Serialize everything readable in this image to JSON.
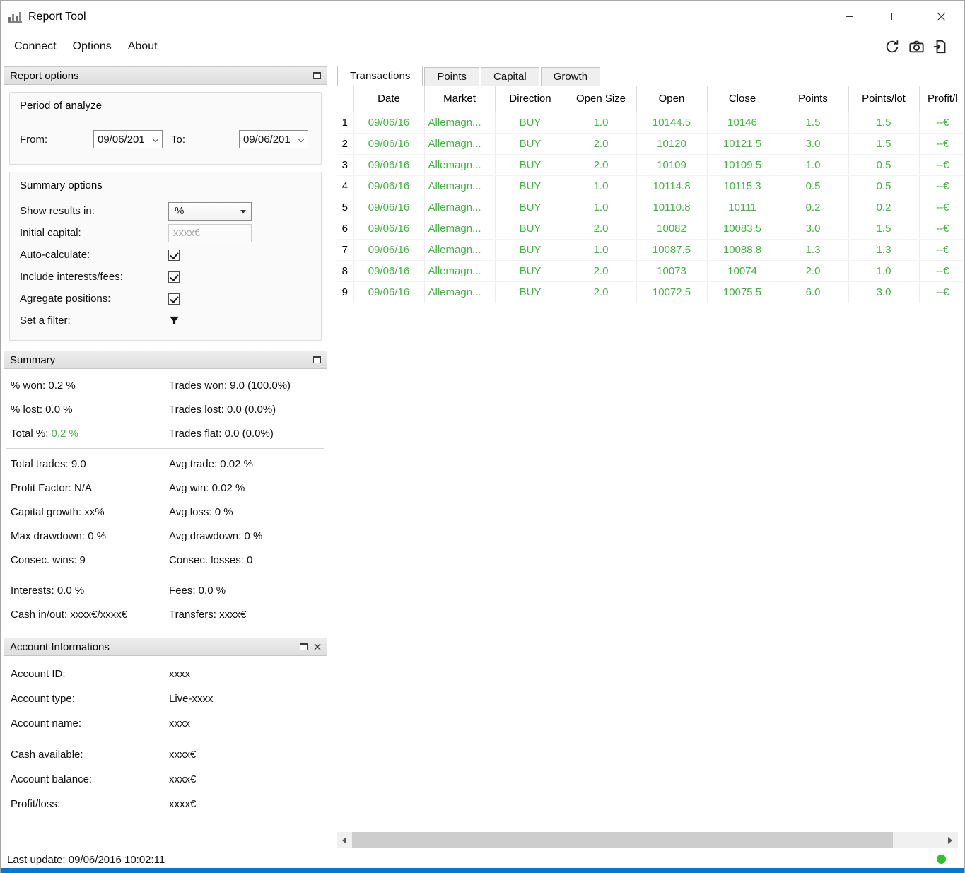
{
  "window": {
    "title": "Report Tool"
  },
  "menubar": {
    "items": [
      "Connect",
      "Options",
      "About"
    ]
  },
  "icons": {
    "app_icon": "bar-chart",
    "refresh_icon": "circular-arrows",
    "camera_icon": "camera",
    "export_icon": "export-arrow",
    "filter_icon": "funnel",
    "status_indicator": "green-dot"
  },
  "colors": {
    "green": "#3fb63f",
    "accent_blue": "#0078d7",
    "status_dot": "#2fc12f"
  },
  "report_options": {
    "header": "Report options",
    "period": {
      "title": "Period of analyze",
      "from_label": "From:",
      "from_value": "09/06/201",
      "to_label": "To:",
      "to_value": "09/06/201"
    },
    "options": {
      "title": "Summary options",
      "show_results_label": "Show results in:",
      "show_results_value": "%",
      "initial_capital_label": "Initial capital:",
      "initial_capital_value": "xxxx€",
      "auto_calculate_label": "Auto-calculate:",
      "interests_label": "Include interests/fees:",
      "agregate_label": "Agregate positions:",
      "filter_label": "Set a filter:"
    }
  },
  "summary": {
    "header": "Summary",
    "g1": [
      {
        "l": "% won: 0.2 %",
        "r": "Trades won: 9.0 (100.0%)"
      },
      {
        "l": "% lost: 0.0 %",
        "r": "Trades lost: 0.0 (0.0%)"
      }
    ],
    "total_label": "Total %:",
    "total_value": "0.2 %",
    "total_right": "Trades flat: 0.0 (0.0%)",
    "g2": [
      {
        "l": "Total trades: 9.0",
        "r": "Avg trade: 0.02 %"
      },
      {
        "l": "Profit Factor: N/A",
        "r": "Avg win: 0.02 %"
      },
      {
        "l": "Capital growth: xx%",
        "r": "Avg loss: 0 %"
      },
      {
        "l": "Max drawdown: 0 %",
        "r": "Avg drawdown: 0 %"
      },
      {
        "l": "Consec. wins: 9",
        "r": "Consec. losses: 0"
      }
    ],
    "g3": [
      {
        "l": "Interests: 0.0 %",
        "r": "Fees: 0.0 %"
      },
      {
        "l": "Cash in/out: xxxx€/xxxx€",
        "r": "Transfers: xxxx€"
      }
    ]
  },
  "account": {
    "header": "Account Informations",
    "g1": [
      {
        "label": "Account ID:",
        "value": "xxxx"
      },
      {
        "label": "Account type:",
        "value": "Live-xxxx"
      },
      {
        "label": "Account name:",
        "value": "xxxx"
      }
    ],
    "g2": [
      {
        "label": "Cash available:",
        "value": "xxxx€"
      },
      {
        "label": "Account balance:",
        "value": "xxxx€"
      },
      {
        "label": "Profit/loss:",
        "value": "xxxx€"
      }
    ]
  },
  "tabs": [
    {
      "label": "Transactions",
      "active": true
    },
    {
      "label": "Points",
      "active": false
    },
    {
      "label": "Capital",
      "active": false
    },
    {
      "label": "Growth",
      "active": false
    }
  ],
  "table": {
    "columns": [
      "Date",
      "Market",
      "Direction",
      "Open Size",
      "Open",
      "Close",
      "Points",
      "Points/lot",
      "Profit/l"
    ],
    "rows": [
      {
        "num": "1",
        "cells": [
          "09/06/16",
          "Allemagn...",
          "BUY",
          "1.0",
          "10144.5",
          "10146",
          "1.5",
          "1.5",
          "--€"
        ]
      },
      {
        "num": "2",
        "cells": [
          "09/06/16",
          "Allemagn...",
          "BUY",
          "2.0",
          "10120",
          "10121.5",
          "3.0",
          "1.5",
          "--€"
        ]
      },
      {
        "num": "3",
        "cells": [
          "09/06/16",
          "Allemagn...",
          "BUY",
          "2.0",
          "10109",
          "10109.5",
          "1.0",
          "0.5",
          "--€"
        ]
      },
      {
        "num": "4",
        "cells": [
          "09/06/16",
          "Allemagn...",
          "BUY",
          "1.0",
          "10114.8",
          "10115.3",
          "0.5",
          "0.5",
          "--€"
        ]
      },
      {
        "num": "5",
        "cells": [
          "09/06/16",
          "Allemagn...",
          "BUY",
          "1.0",
          "10110.8",
          "10111",
          "0.2",
          "0.2",
          "--€"
        ]
      },
      {
        "num": "6",
        "cells": [
          "09/06/16",
          "Allemagn...",
          "BUY",
          "2.0",
          "10082",
          "10083.5",
          "3.0",
          "1.5",
          "--€"
        ]
      },
      {
        "num": "7",
        "cells": [
          "09/06/16",
          "Allemagn...",
          "BUY",
          "1.0",
          "10087.5",
          "10088.8",
          "1.3",
          "1.3",
          "--€"
        ]
      },
      {
        "num": "8",
        "cells": [
          "09/06/16",
          "Allemagn...",
          "BUY",
          "2.0",
          "10073",
          "10074",
          "2.0",
          "1.0",
          "--€"
        ]
      },
      {
        "num": "9",
        "cells": [
          "09/06/16",
          "Allemagn...",
          "BUY",
          "2.0",
          "10072.5",
          "10075.5",
          "6.0",
          "3.0",
          "--€"
        ]
      }
    ]
  },
  "statusbar": {
    "text": "Last update: 09/06/2016 10:02:11"
  }
}
